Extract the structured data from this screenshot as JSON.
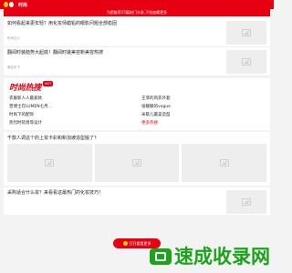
{
  "header": {
    "title": "时尚"
  },
  "notice": {
    "text": "为您推荐15篇热门头条,下拉加载更多"
  },
  "feed_top": [
    {
      "title": "如何看起来更年轻？用化妆师蜡铅的眼影问题全部稳固",
      "source": "时尚达人"
    },
    {
      "title": "翻阅时装趋势大起底！翻阅时装美容新美容热搜",
      "source": "美容天下"
    }
  ],
  "hot": {
    "logo_text": "时尚热搜",
    "badge": "HOT",
    "items": [
      "衣服新人人最爱款",
      "王菲的风衣外套",
      "曾博士在LUMEN七月...",
      "张靓颖的vogue",
      "时尚下的配饰",
      "米歇儿最美造型",
      "热烈时装周等设计",
      "更多热搜"
    ]
  },
  "gallery": {
    "title": "千款人调这个的上妆卡彩和新加坡造型版了？"
  },
  "bottom_item": {
    "title": "采购适合什么妆？来看看这最热门的化妆技巧！"
  },
  "float_button": {
    "label": "打开看看更多"
  },
  "watermark": {
    "text": "速成收录网"
  }
}
